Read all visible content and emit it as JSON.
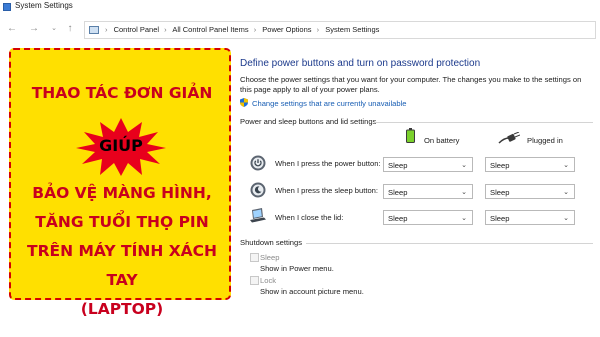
{
  "window": {
    "title": "System Settings"
  },
  "breadcrumb": [
    "Control Panel",
    "All Control Panel Items",
    "Power Options",
    "System Settings"
  ],
  "banner": {
    "line1": "THAO TÁC ĐƠN GIẢN",
    "highlight": "GIÚP",
    "line2": "BẢO VỆ MÀNG HÌNH,",
    "line3": "TĂNG TUỔI THỌ PIN",
    "line4": "TRÊN MÁY TÍNH XÁCH TAY",
    "line5": "(LAPTOP)"
  },
  "main": {
    "heading": "Define power buttons and turn on password protection",
    "description": "Choose the power settings that you want for your computer. The changes you make to the settings on this page apply to all of your power plans.",
    "change_link": "Change settings that are currently unavailable",
    "section_power": "Power and sleep buttons and lid settings",
    "col_battery": "On battery",
    "col_plugged": "Plugged in",
    "rows": [
      {
        "label": "When I press the power button:",
        "battery": "Sleep",
        "plugged": "Sleep",
        "icon": "power-button-icon"
      },
      {
        "label": "When I press the sleep button:",
        "battery": "Sleep",
        "plugged": "Sleep",
        "icon": "sleep-button-icon"
      },
      {
        "label": "When I close the lid:",
        "battery": "Sleep",
        "plugged": "Sleep",
        "icon": "laptop-lid-icon"
      }
    ],
    "section_shutdown": "Shutdown settings",
    "shutdown": [
      {
        "label": "Sleep",
        "sub": "Show in Power menu."
      },
      {
        "label": "Lock",
        "sub": "Show in account picture menu."
      }
    ]
  }
}
